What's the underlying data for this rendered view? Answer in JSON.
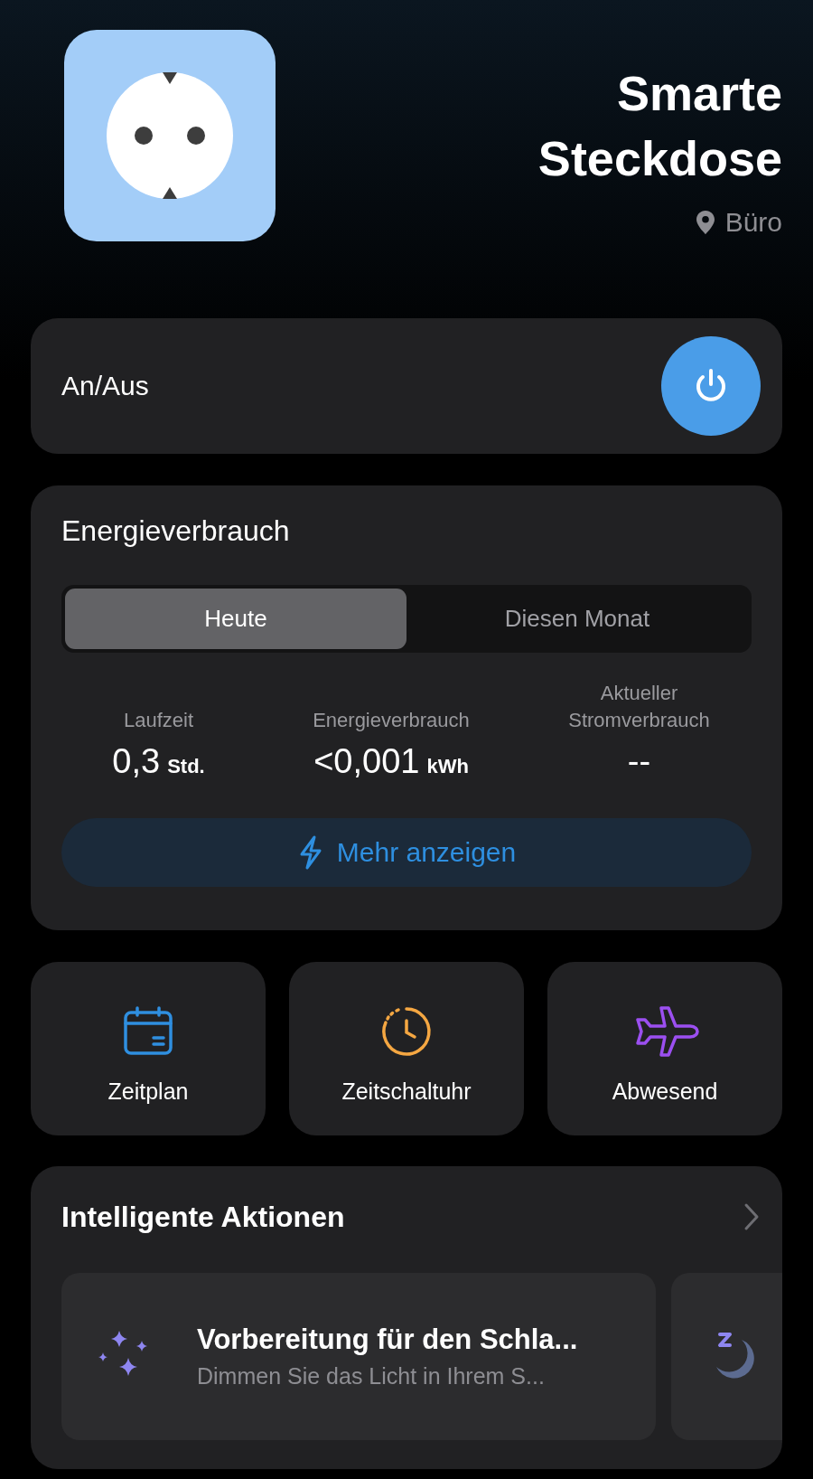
{
  "device": {
    "name": "Smarte Steckdose",
    "location": "Büro"
  },
  "power": {
    "label": "An/Aus",
    "on": true
  },
  "energy": {
    "title": "Energieverbrauch",
    "tabs": [
      {
        "label": "Heute",
        "selected": true
      },
      {
        "label": "Diesen Monat",
        "selected": false
      }
    ],
    "stats": [
      {
        "label": "Laufzeit",
        "value": "0,3",
        "unit": "Std."
      },
      {
        "label": "Energieverbrauch",
        "value": "<0,001",
        "unit": "kWh"
      },
      {
        "label": "Aktueller Stromverbrauch",
        "value": "--"
      }
    ],
    "more_button": "Mehr anzeigen"
  },
  "shortcuts": [
    {
      "kind": "schedule",
      "label": "Zeitplan"
    },
    {
      "kind": "timer",
      "label": "Zeitschaltuhr"
    },
    {
      "kind": "away",
      "label": "Abwesend"
    }
  ],
  "smart_actions": {
    "title": "Intelligente Aktionen",
    "items": [
      {
        "kind": "sparkles",
        "title": "Vorbereitung für den Schla...",
        "subtitle": "Dimmen Sie das Licht in Ihrem S..."
      },
      {
        "kind": "moon"
      }
    ]
  }
}
